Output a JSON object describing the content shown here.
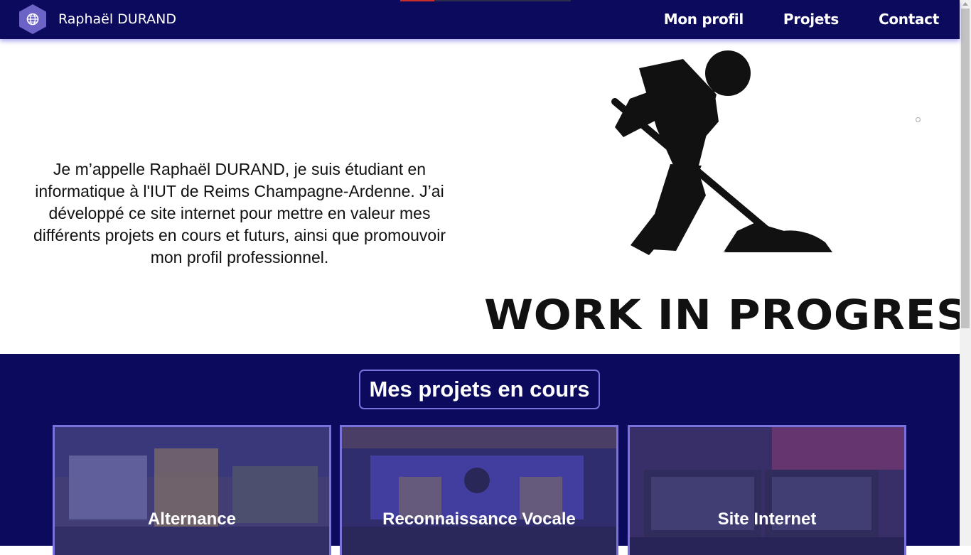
{
  "header": {
    "brand_name": "Raphaël DURAND",
    "logo_icon": "globe-hexagon-icon",
    "nav": [
      {
        "label": "Mon profil"
      },
      {
        "label": "Projets"
      },
      {
        "label": "Contact"
      }
    ]
  },
  "hero": {
    "intro": "Je m’appelle Raphaël DURAND, je suis étudiant en informatique à l'IUT de Reims Champagne-Ardenne. J’ai développé ce site internet pour mettre en valeur mes différents projets en cours et futurs, ainsi que promouvoir mon profil professionnel.",
    "image_caption": "WORK IN PROGRESS",
    "image_icon": "worker-shoveling-icon"
  },
  "projects": {
    "title": "Mes projets en cours",
    "cards": [
      {
        "title": "Alternance"
      },
      {
        "title": "Reconnaissance Vocale"
      },
      {
        "title": "Site Internet"
      }
    ]
  },
  "colors": {
    "navy": "#0b0a5c",
    "accent": "#7a72dc",
    "logo": "#6c63c7"
  }
}
